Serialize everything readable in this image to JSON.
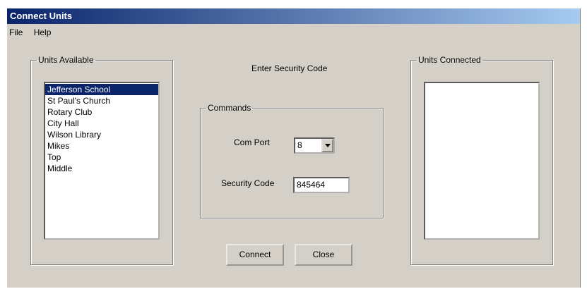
{
  "window": {
    "title": "Connect Units"
  },
  "menu": [
    "File",
    "Help"
  ],
  "units_available": {
    "legend": "Units Available",
    "items": [
      "Jefferson School",
      "St Paul's Church",
      "Rotary Club",
      "City Hall",
      "Wilson Library",
      "Mikes",
      "Top",
      "Middle"
    ],
    "selected_index": 0
  },
  "prompt": "Enter Security Code",
  "commands": {
    "legend": "Commands",
    "com_port_label": "Com Port",
    "com_port_value": "8",
    "security_code_label": "Security Code",
    "security_code_value": "845464"
  },
  "buttons": {
    "connect": "Connect",
    "close": "Close"
  },
  "units_connected": {
    "legend": "Units Connected",
    "items": []
  }
}
